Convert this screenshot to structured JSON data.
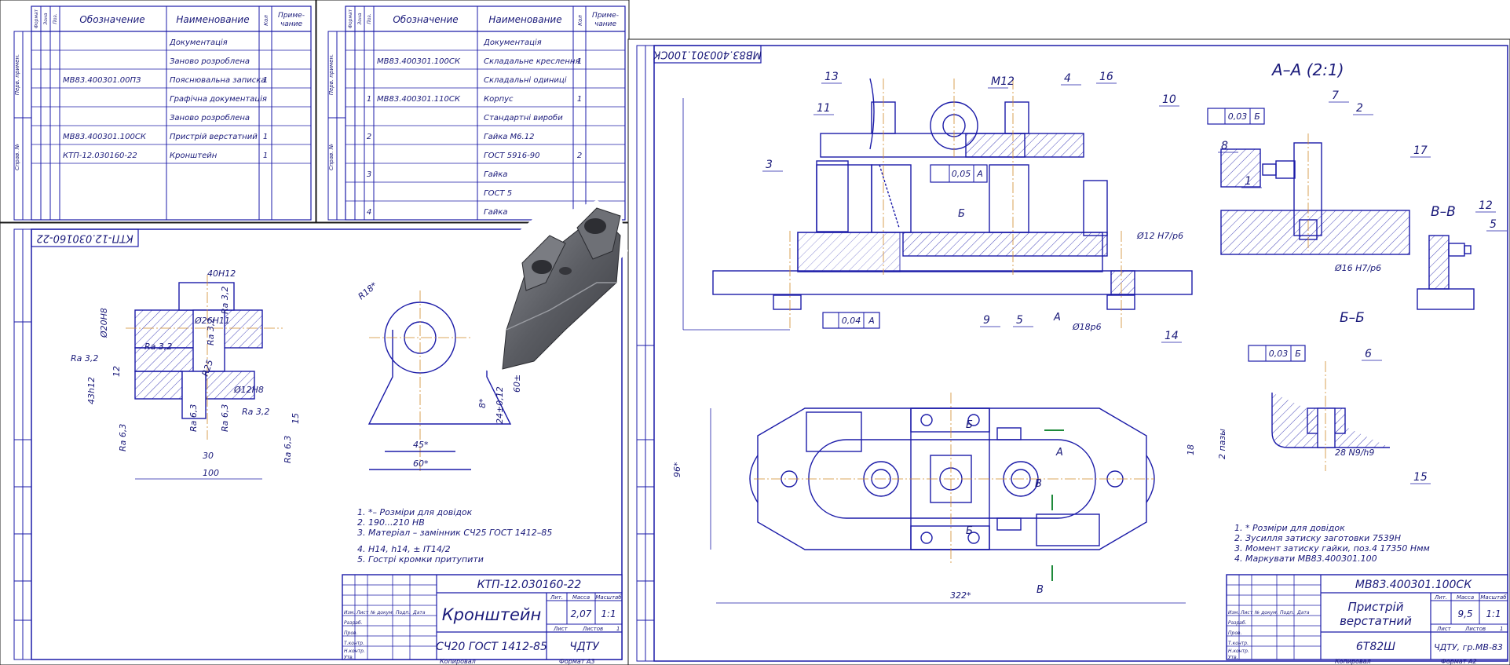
{
  "spec_left": {
    "headers": {
      "format": "Формат",
      "zone": "Зона",
      "pos": "Поз.",
      "designation": "Обозначение",
      "name": "Наименование",
      "qty": "Кол",
      "note": "Приме-\nчание"
    },
    "rows": [
      {
        "pos": "",
        "designation": "",
        "name": "Документація",
        "qty": "",
        "underline": true
      },
      {
        "pos": "",
        "designation": "",
        "name": "Заново розроблена",
        "qty": ""
      },
      {
        "pos": "",
        "designation": "МВ83.400301.00ПЗ",
        "name": "Пояснювальна записка",
        "qty": "1"
      },
      {
        "pos": "",
        "designation": "",
        "name": "Графічна документація",
        "qty": "",
        "underline": true
      },
      {
        "pos": "",
        "designation": "",
        "name": "Заново розроблена",
        "qty": ""
      },
      {
        "pos": "",
        "designation": "МВ83.400301.100СК",
        "name": "Пристрій верстатний",
        "qty": "1"
      },
      {
        "pos": "",
        "designation": "КТП-12.030160-22",
        "name": "Кронштейн",
        "qty": "1"
      }
    ],
    "side_labels": [
      "Перв. примен.",
      "Справ. №"
    ]
  },
  "spec_right": {
    "headers": {
      "format": "Формат",
      "zone": "Зона",
      "pos": "Поз.",
      "designation": "Обозначение",
      "name": "Наименование",
      "qty": "Кол",
      "note": "Приме-\nчание"
    },
    "rows": [
      {
        "pos": "",
        "designation": "",
        "name": "Документація",
        "qty": ""
      },
      {
        "pos": "",
        "designation": "МВ83.400301.100СК",
        "name": "Складальне креслення",
        "qty": "1"
      },
      {
        "pos": "",
        "designation": "",
        "name": "Складальні одиниці",
        "qty": ""
      },
      {
        "pos": "1",
        "designation": "МВ83.400301.110СК",
        "name": "Корпус",
        "qty": "1"
      },
      {
        "pos": "",
        "designation": "",
        "name": "Стандартні вироби",
        "qty": ""
      },
      {
        "pos": "2",
        "designation": "",
        "name": "Гайка М6.12",
        "qty": ""
      },
      {
        "pos": "",
        "designation": "",
        "name": "ГОСТ 5916-90",
        "qty": "2"
      },
      {
        "pos": "3",
        "designation": "",
        "name": "Гайка",
        "qty": ""
      },
      {
        "pos": "",
        "designation": "",
        "name": "ГОСТ 5",
        "qty": ""
      },
      {
        "pos": "4",
        "designation": "",
        "name": "Гайка",
        "qty": ""
      }
    ]
  },
  "part_drawing": {
    "code_rotated": "КТП-12.030160-22",
    "dims": [
      "40Н12",
      "Ø26Н11",
      "Ø20Н8",
      "Ra 3,2",
      "Ra 3,2",
      "Ra 3,2",
      "Ra 3,2",
      "12",
      "43h12",
      "Ra 6,3",
      "Ra 6,3",
      "Ra 6,3",
      "Ra 6,3",
      "R25",
      "Ø12Н8",
      "15",
      "Ra 3,2",
      "30",
      "100",
      "R18*",
      "45*",
      "60*",
      "8*",
      "24±0,12",
      "60±",
      "R25"
    ],
    "notes": [
      "1. *– Розміри для довідок",
      "2. 190...210 НВ",
      "3. Матеріал – замінник СЧ25 ГОСТ 1412–85",
      "4. Н14, h14, ± IT14/2",
      "5. Гострі кромки притупити"
    ],
    "title_block": {
      "doc_code": "КТП-12.030160-22",
      "name": "Кронштейн",
      "material": "СЧ20 ГОСТ 1412-85",
      "org": "ЧДТУ",
      "mass": "2,07",
      "scale": "1:1",
      "sheet_label": "Лист",
      "sheets_label": "Листов",
      "sheets": "1",
      "lit_label": "Лит.",
      "mass_label": "Масса",
      "scale_label": "Масштаб",
      "change_labels": [
        "Изм.",
        "Лист",
        "№ докум.",
        "Подп.",
        "Дата"
      ],
      "role_labels": [
        "Разраб.",
        "Пров.",
        "Т.контр.",
        "",
        "Н.контр.",
        "Утв."
      ],
      "copied": "Копировал",
      "format": "Формат   А3"
    }
  },
  "assembly": {
    "code_rotated": "МВ83.400301.100СК",
    "callouts": [
      "13",
      "11",
      "3",
      "М12",
      "4",
      "16",
      "10",
      "8",
      "1",
      "9",
      "5",
      "14",
      "7",
      "2",
      "17",
      "12",
      "5",
      "6",
      "15"
    ],
    "section_titles": {
      "aa": "А–А (2:1)",
      "bb": "В–В",
      "bsec": "Б–Б"
    },
    "dims": [
      "Ø12 Н7/р6",
      "Ø18р6",
      "Ø16 Н7/р6",
      "28 N9/h9",
      "96*",
      "322*",
      "18",
      "2 пазы"
    ],
    "tolerances": [
      "0,05",
      "А",
      "0,04",
      "А",
      "0,03",
      "Б",
      "0,03",
      "Б"
    ],
    "markers": [
      "Б",
      "А",
      "А",
      "В",
      "В",
      "Б",
      "Б",
      "В"
    ],
    "notes": [
      "1. * Розміри для довідок",
      "2. Зусилля затиску заготовки 7539Н",
      "3. Момент затиску гайки, поз.4  17350 Нмм",
      "4. Маркувати МВ83.400301.100"
    ],
    "title_block": {
      "doc_code": "МВ83.400301.100СК",
      "name1": "Пристрій",
      "name2": "верстатний",
      "group": "6Т82Ш",
      "org": "ЧДТУ, гр.МВ-83",
      "mass": "9,5",
      "scale": "1:1",
      "lit_label": "Лит.",
      "mass_label": "Масса",
      "scale_label": "Масштаб",
      "sheet_label": "Лист",
      "sheets_label": "Листов",
      "sheets": "1",
      "change_labels": [
        "Изм.",
        "Лист",
        "№ докум.",
        "Подп.",
        "Дата"
      ],
      "role_labels": [
        "Разраб.",
        "Пров.",
        "Т.контр.",
        "",
        "Н.контр.",
        "Утв."
      ],
      "copied": "Копировал",
      "format": "Формат   А2"
    }
  },
  "colors": {
    "line": "#1b1ba8",
    "ink": "#1a1a7a",
    "frame": "#1a1a1a",
    "axis": "#d08a2a",
    "green": "#1e8a3a",
    "part3d": "#5e6066"
  }
}
